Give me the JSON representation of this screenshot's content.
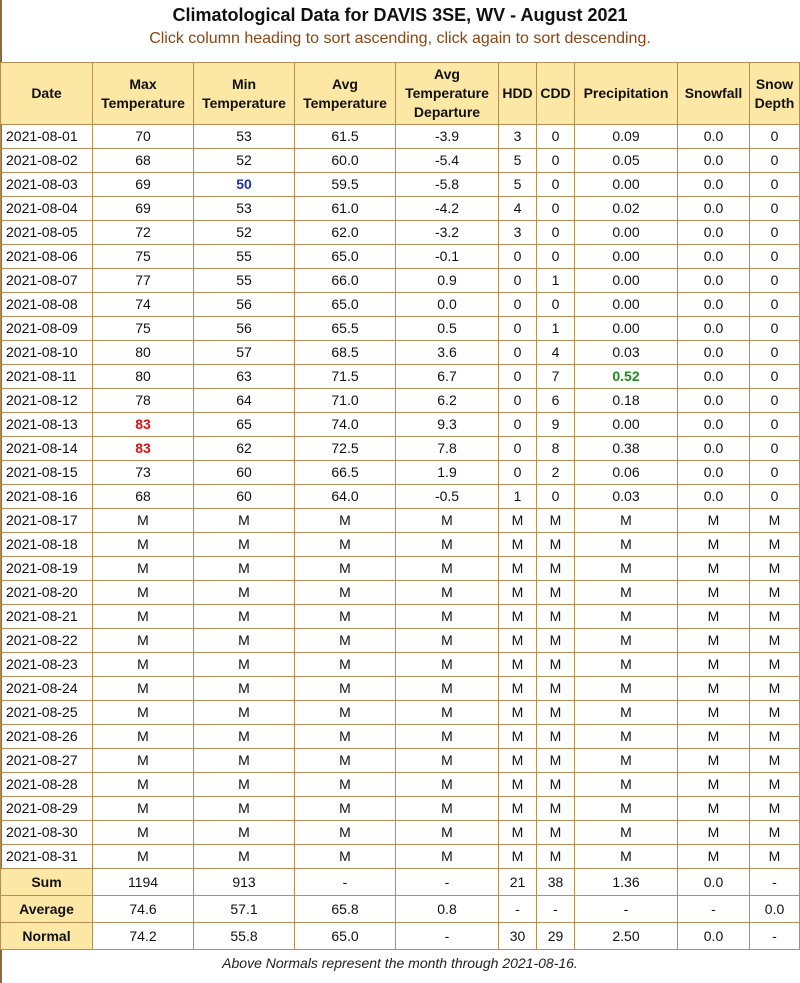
{
  "title": "Climatological Data for DAVIS 3SE, WV - August 2021",
  "subtitle": "Click column heading to sort ascending, click again to sort descending.",
  "columns": [
    {
      "key": "date",
      "label": "Date",
      "name": "col-date"
    },
    {
      "key": "max",
      "label": "Max Temperature",
      "name": "col-max-temperature"
    },
    {
      "key": "min",
      "label": "Min Temperature",
      "name": "col-min-temperature"
    },
    {
      "key": "avg",
      "label": "Avg Temperature",
      "name": "col-avg-temperature"
    },
    {
      "key": "dep",
      "label": "Avg Temperature Departure",
      "name": "col-avg-temperature-departure"
    },
    {
      "key": "hdd",
      "label": "HDD",
      "name": "col-hdd"
    },
    {
      "key": "cdd",
      "label": "CDD",
      "name": "col-cdd"
    },
    {
      "key": "pcp",
      "label": "Precipitation",
      "name": "col-precipitation"
    },
    {
      "key": "snow",
      "label": "Snowfall",
      "name": "col-snowfall"
    },
    {
      "key": "depth",
      "label": "Snow Depth",
      "name": "col-snow-depth"
    }
  ],
  "highlight_colors": {
    "record_high": "#d11111",
    "record_low": "#1a2fb8",
    "max_precip": "#1f8a1f"
  },
  "rows": [
    [
      "2021-08-01",
      "70",
      "53",
      "61.5",
      "-3.9",
      "3",
      "0",
      "0.09",
      "0.0",
      "0"
    ],
    [
      "2021-08-02",
      "68",
      "52",
      "60.0",
      "-5.4",
      "5",
      "0",
      "0.05",
      "0.0",
      "0"
    ],
    [
      "2021-08-03",
      "69",
      "50",
      "59.5",
      "-5.8",
      "5",
      "0",
      "0.00",
      "0.0",
      "0"
    ],
    [
      "2021-08-04",
      "69",
      "53",
      "61.0",
      "-4.2",
      "4",
      "0",
      "0.02",
      "0.0",
      "0"
    ],
    [
      "2021-08-05",
      "72",
      "52",
      "62.0",
      "-3.2",
      "3",
      "0",
      "0.00",
      "0.0",
      "0"
    ],
    [
      "2021-08-06",
      "75",
      "55",
      "65.0",
      "-0.1",
      "0",
      "0",
      "0.00",
      "0.0",
      "0"
    ],
    [
      "2021-08-07",
      "77",
      "55",
      "66.0",
      "0.9",
      "0",
      "1",
      "0.00",
      "0.0",
      "0"
    ],
    [
      "2021-08-08",
      "74",
      "56",
      "65.0",
      "0.0",
      "0",
      "0",
      "0.00",
      "0.0",
      "0"
    ],
    [
      "2021-08-09",
      "75",
      "56",
      "65.5",
      "0.5",
      "0",
      "1",
      "0.00",
      "0.0",
      "0"
    ],
    [
      "2021-08-10",
      "80",
      "57",
      "68.5",
      "3.6",
      "0",
      "4",
      "0.03",
      "0.0",
      "0"
    ],
    [
      "2021-08-11",
      "80",
      "63",
      "71.5",
      "6.7",
      "0",
      "7",
      "0.52",
      "0.0",
      "0"
    ],
    [
      "2021-08-12",
      "78",
      "64",
      "71.0",
      "6.2",
      "0",
      "6",
      "0.18",
      "0.0",
      "0"
    ],
    [
      "2021-08-13",
      "83",
      "65",
      "74.0",
      "9.3",
      "0",
      "9",
      "0.00",
      "0.0",
      "0"
    ],
    [
      "2021-08-14",
      "83",
      "62",
      "72.5",
      "7.8",
      "0",
      "8",
      "0.38",
      "0.0",
      "0"
    ],
    [
      "2021-08-15",
      "73",
      "60",
      "66.5",
      "1.9",
      "0",
      "2",
      "0.06",
      "0.0",
      "0"
    ],
    [
      "2021-08-16",
      "68",
      "60",
      "64.0",
      "-0.5",
      "1",
      "0",
      "0.03",
      "0.0",
      "0"
    ],
    [
      "2021-08-17",
      "M",
      "M",
      "M",
      "M",
      "M",
      "M",
      "M",
      "M",
      "M"
    ],
    [
      "2021-08-18",
      "M",
      "M",
      "M",
      "M",
      "M",
      "M",
      "M",
      "M",
      "M"
    ],
    [
      "2021-08-19",
      "M",
      "M",
      "M",
      "M",
      "M",
      "M",
      "M",
      "M",
      "M"
    ],
    [
      "2021-08-20",
      "M",
      "M",
      "M",
      "M",
      "M",
      "M",
      "M",
      "M",
      "M"
    ],
    [
      "2021-08-21",
      "M",
      "M",
      "M",
      "M",
      "M",
      "M",
      "M",
      "M",
      "M"
    ],
    [
      "2021-08-22",
      "M",
      "M",
      "M",
      "M",
      "M",
      "M",
      "M",
      "M",
      "M"
    ],
    [
      "2021-08-23",
      "M",
      "M",
      "M",
      "M",
      "M",
      "M",
      "M",
      "M",
      "M"
    ],
    [
      "2021-08-24",
      "M",
      "M",
      "M",
      "M",
      "M",
      "M",
      "M",
      "M",
      "M"
    ],
    [
      "2021-08-25",
      "M",
      "M",
      "M",
      "M",
      "M",
      "M",
      "M",
      "M",
      "M"
    ],
    [
      "2021-08-26",
      "M",
      "M",
      "M",
      "M",
      "M",
      "M",
      "M",
      "M",
      "M"
    ],
    [
      "2021-08-27",
      "M",
      "M",
      "M",
      "M",
      "M",
      "M",
      "M",
      "M",
      "M"
    ],
    [
      "2021-08-28",
      "M",
      "M",
      "M",
      "M",
      "M",
      "M",
      "M",
      "M",
      "M"
    ],
    [
      "2021-08-29",
      "M",
      "M",
      "M",
      "M",
      "M",
      "M",
      "M",
      "M",
      "M"
    ],
    [
      "2021-08-30",
      "M",
      "M",
      "M",
      "M",
      "M",
      "M",
      "M",
      "M",
      "M"
    ],
    [
      "2021-08-31",
      "M",
      "M",
      "M",
      "M",
      "M",
      "M",
      "M",
      "M",
      "M"
    ]
  ],
  "highlights": [
    {
      "date": "2021-08-03",
      "col": 2,
      "type": "record_low"
    },
    {
      "date": "2021-08-11",
      "col": 7,
      "type": "max_precip"
    },
    {
      "date": "2021-08-13",
      "col": 1,
      "type": "record_high"
    },
    {
      "date": "2021-08-14",
      "col": 1,
      "type": "record_high"
    }
  ],
  "summary": [
    [
      "Sum",
      "1194",
      "913",
      "-",
      "-",
      "21",
      "38",
      "1.36",
      "0.0",
      "-"
    ],
    [
      "Average",
      "74.6",
      "57.1",
      "65.8",
      "0.8",
      "-",
      "-",
      "-",
      "-",
      "0.0"
    ],
    [
      "Normal",
      "74.2",
      "55.8",
      "65.0",
      "-",
      "30",
      "29",
      "2.50",
      "0.0",
      "-"
    ]
  ],
  "footnote": "Above Normals represent the month through 2021-08-16."
}
